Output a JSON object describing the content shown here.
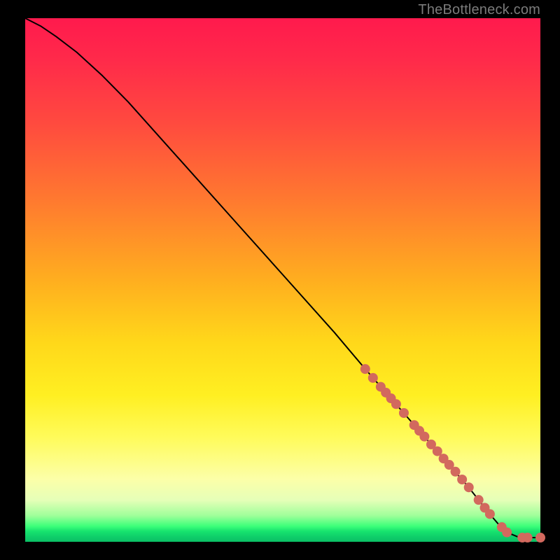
{
  "watermark": "TheBottleneck.com",
  "colors": {
    "background": "#000000",
    "line": "#000000",
    "dot": "#d2695e",
    "dot_stroke": "#c25a50"
  },
  "chart_data": {
    "type": "line",
    "title": "",
    "xlabel": "",
    "ylabel": "",
    "xlim": [
      0,
      100
    ],
    "ylim": [
      0,
      100
    ],
    "grid": false,
    "legend": false,
    "series": [
      {
        "name": "curve",
        "x": [
          0,
          3,
          6,
          10,
          15,
          20,
          30,
          40,
          50,
          60,
          66,
          70,
          74,
          78,
          82,
          86,
          88,
          90,
          92,
          94,
          96,
          98,
          100
        ],
        "y": [
          100,
          98.5,
          96.5,
          93.5,
          89,
          84,
          73,
          62,
          51,
          40,
          33,
          28.5,
          24,
          19.5,
          15,
          10.5,
          8,
          5.5,
          3.2,
          1.6,
          0.8,
          0.8,
          0.8
        ]
      }
    ],
    "dots": {
      "name": "highlighted-points",
      "x": [
        66.0,
        67.5,
        69.0,
        70.0,
        71.0,
        72.0,
        73.5,
        75.5,
        76.5,
        77.5,
        78.8,
        80.0,
        81.2,
        82.3,
        83.5,
        84.8,
        86.1,
        88.0,
        89.2,
        90.2,
        92.5,
        93.5,
        96.5,
        97.5,
        100.0
      ],
      "y": [
        33.0,
        31.3,
        29.6,
        28.5,
        27.4,
        26.3,
        24.6,
        22.3,
        21.2,
        20.1,
        18.6,
        17.3,
        15.9,
        14.7,
        13.4,
        11.9,
        10.4,
        8.0,
        6.5,
        5.3,
        2.8,
        1.8,
        0.8,
        0.8,
        0.8
      ]
    }
  }
}
